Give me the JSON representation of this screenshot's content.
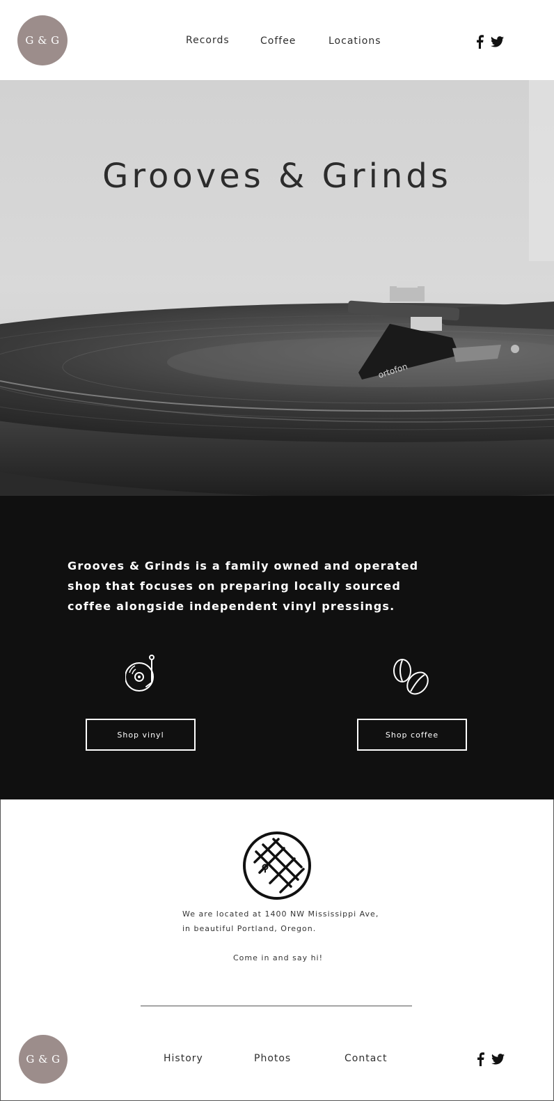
{
  "header": {
    "logo_text": "G & G",
    "nav": [
      "Records",
      "Coffee",
      "Locations"
    ],
    "social": [
      "facebook-icon",
      "twitter-icon"
    ]
  },
  "hero": {
    "title": "Grooves & Grinds",
    "cartridge_brand": "ortofon"
  },
  "about": {
    "text": "Grooves & Grinds is a family owned and operated shop that focuses on preparing locally sourced coffee alongside independent vinyl pressings.",
    "shop_vinyl": "Shop vinyl",
    "shop_coffee": "Shop coffee",
    "icons": [
      "turntable-icon",
      "coffee-beans-icon"
    ]
  },
  "location": {
    "line1": "We are located at 1400 NW Mississippi Ave,",
    "line2": "in beautiful Portland, Oregon.",
    "line3": "Come in and say hi!",
    "icon": "map-icon"
  },
  "footer": {
    "logo_text": "G & G",
    "nav": [
      "History",
      "Photos",
      "Contact"
    ],
    "social": [
      "facebook-icon",
      "twitter-icon"
    ]
  },
  "colors": {
    "logo_bg": "#9c8d8b",
    "dark_bg": "#101010",
    "text": "#2b2b2b"
  }
}
